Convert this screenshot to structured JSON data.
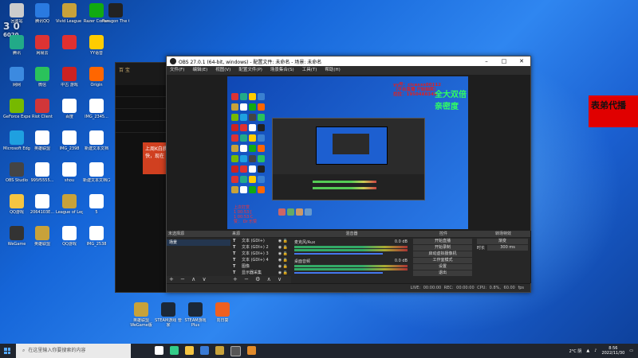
{
  "badge": {
    "number": "3 0",
    "sub": "6020"
  },
  "desktop_icons": [
    {
      "label": "",
      "c": "#2a6"
    },
    {
      "label": "网网",
      "c": "#3a80d0"
    },
    {
      "label": "",
      "c": "#5a8"
    },
    {
      "label": "",
      "c": "#4a6"
    },
    {
      "label": "",
      "c": "#111"
    },
    {
      "label": "回收站",
      "c": "#ccc"
    },
    {
      "label": "网易云",
      "c": "#d33"
    },
    {
      "label": "Vivid League o...",
      "c": "#c8a23a"
    },
    {
      "label": "Razer Cortex",
      "c": "#181"
    },
    {
      "label": "Paragon The Ove...",
      "c": "#222"
    }
  ],
  "desktop_labels": {
    "row1": [
      "网网",
      "腾讯QQ",
      "Vivid League ...",
      "Razer Cortex",
      "Paragon The Ove..."
    ],
    "col1": [
      "回收站",
      "腾讯",
      "网网",
      "GeForce Experience",
      "Microsoft Edge",
      "OBS Studio",
      "QQ游戏",
      "WeGame"
    ],
    "col2": [
      "网易云",
      "微信",
      "Riot Client",
      "英雄联盟",
      "995f5555...",
      "2064103E...",
      "英雄联盟"
    ],
    "col3": [
      "",
      "中古 游戏 游戏 应用",
      "百度",
      "IMG_2398",
      "shou",
      "League of Legends",
      "QQ游戏"
    ],
    "col4": [
      "YY语音",
      "Origin",
      "IMG_2345...",
      "新建文本文档",
      "新建文本文档(2)",
      "5",
      "IMG_2538"
    ],
    "bottom": [
      "英雄联盟 WeGame版",
      "STEAM游戏 管家",
      "STEAM游戏 Plus",
      "向日葵"
    ]
  },
  "red_banner": "表弟代播",
  "lol": {
    "title": "百 宝",
    "side": "上周K白质，快，现在"
  },
  "obs": {
    "title": "OBS 27.0.1 (64-bit, windows) - 配置文件: 未命名 - 场景: 未命名",
    "menu": [
      "文件(F)",
      "编辑(E)",
      "视图(V)",
      "配置文件(P)",
      "场景集合(S)",
      "工具(T)",
      "帮助(H)"
    ],
    "preview_caption": [
      "yy号：cicaxxx00112",
      "（平台直播 开始抽奖）",
      "拉拉：1950488349"
    ],
    "preview_main": "全大双倍亲密度",
    "preview_text": [
      "上次打赏",
      "1  00:53:[",
      "1  00:53:C",
      "赞：  Or 乐赞"
    ],
    "docks": {
      "scenes": {
        "title": "未选择源",
        "items": [
          "场景"
        ]
      },
      "sources": {
        "title": "来源",
        "items": [
          "文本 (GDI+)",
          "文本 (GDI+) 2",
          "文本 (GDI+) 3",
          "文本 (GDI+) 4",
          "图像",
          "显示器采集"
        ]
      },
      "mixer": {
        "title": "混音器",
        "tracks": [
          {
            "name": "麦克风/Aux",
            "db": "0.0 dB"
          },
          {
            "name": "桌面音频",
            "db": "0.0 dB"
          }
        ]
      },
      "controls": {
        "title": "控件",
        "buttons": [
          "开始直播",
          "开始录制",
          "启动虚拟摄像机",
          "工作室模式",
          "设置",
          "退出"
        ]
      },
      "transitions": {
        "title": "转场特效",
        "type": "渐变",
        "duration_label": "时长",
        "duration": "300 ms"
      }
    },
    "props": "属性",
    "filters": "滤镜",
    "status": "LIVE: 00:00:00   REC: 00:00:00   CPU: 0.8%, 60.00 fps"
  },
  "taskbar": {
    "search_placeholder": "在这里输入你要搜索的内容",
    "weather": "2°C 阴",
    "time": "8:56",
    "date": "2022/11/30"
  }
}
